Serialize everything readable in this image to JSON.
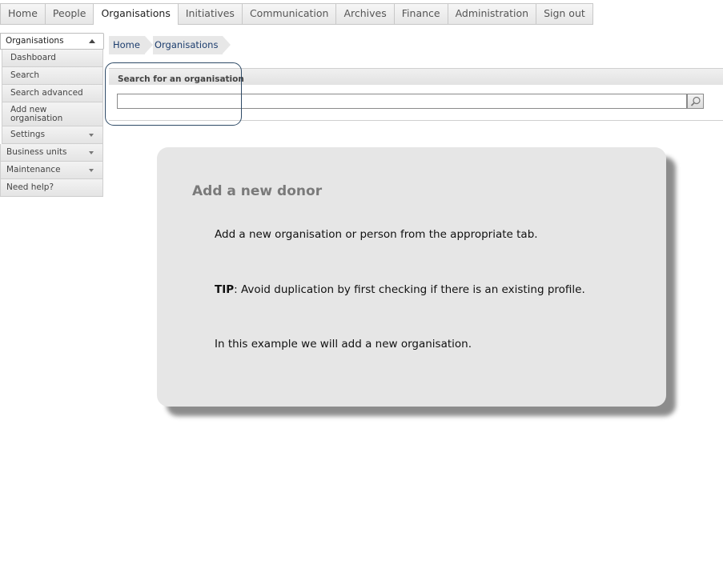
{
  "topnav": {
    "tabs": [
      {
        "label": "Home"
      },
      {
        "label": "People"
      },
      {
        "label": "Organisations"
      },
      {
        "label": "Initiatives"
      },
      {
        "label": "Communication"
      },
      {
        "label": "Archives"
      },
      {
        "label": "Finance"
      },
      {
        "label": "Administration"
      },
      {
        "label": "Sign out"
      }
    ],
    "active": "Organisations"
  },
  "sidebar": {
    "header": "Organisations",
    "items": [
      {
        "label": "Dashboard"
      },
      {
        "label": "Search"
      },
      {
        "label": "Search advanced"
      },
      {
        "label": "Add new organisation"
      },
      {
        "label": "Settings"
      }
    ],
    "sections": [
      {
        "label": "Business units"
      },
      {
        "label": "Maintenance"
      },
      {
        "label": "Need help?"
      }
    ]
  },
  "breadcrumb": [
    "Home",
    "Organisations"
  ],
  "search": {
    "title": "Search for an organisation",
    "value": "",
    "placeholder": ""
  },
  "card": {
    "title": "Add a new donor",
    "line1": "Add a new organisation or person from the appropriate tab.",
    "tip_label": "TIP",
    "tip_text": ": Avoid duplication by first checking if there is an existing profile.",
    "line3": "In this example we will add a new organisation."
  },
  "colors": {
    "highlight_border": "#2e4a66",
    "breadcrumb_text": "#1c3d6e",
    "card_bg": "#e6e6e6"
  },
  "icons": {
    "search_button": "magnifier-icon",
    "sidebar_collapse": "caret-up-icon",
    "submenu": "caret-down-icon"
  }
}
